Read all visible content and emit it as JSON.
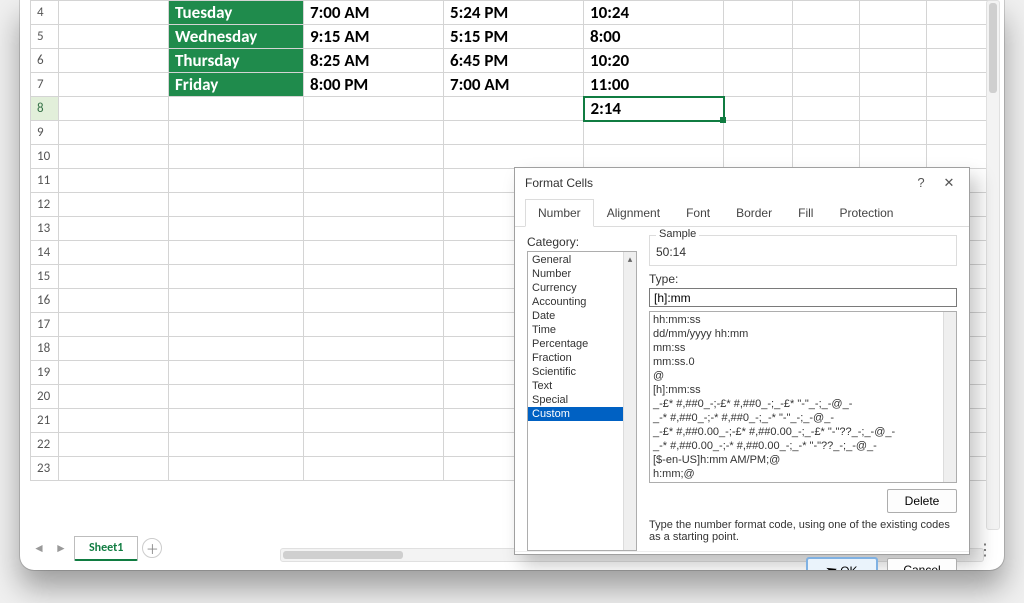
{
  "sheet": {
    "rows": [
      {
        "n": "4",
        "day": "Tuesday",
        "start": "7:00 AM",
        "end": "5:24 PM",
        "dur": "10:24"
      },
      {
        "n": "5",
        "day": "Wednesday",
        "start": "9:15 AM",
        "end": "5:15 PM",
        "dur": "8:00"
      },
      {
        "n": "6",
        "day": "Thursday",
        "start": "8:25 AM",
        "end": "6:45 PM",
        "dur": "10:20"
      },
      {
        "n": "7",
        "day": "Friday",
        "start": "8:00 PM",
        "end": "7:00 AM",
        "dur": "11:00"
      }
    ],
    "sumrow": {
      "n": "8",
      "total": "2:14"
    },
    "empty_rows": [
      "9",
      "10",
      "11",
      "12",
      "13",
      "14",
      "15",
      "16",
      "17",
      "18",
      "19",
      "20",
      "21",
      "22",
      "23"
    ],
    "tab_name": "Sheet1"
  },
  "dialog": {
    "title": "Format Cells",
    "tabs": [
      "Number",
      "Alignment",
      "Font",
      "Border",
      "Fill",
      "Protection"
    ],
    "active_tab": "Number",
    "category_label": "Category:",
    "categories": [
      "General",
      "Number",
      "Currency",
      "Accounting",
      "Date",
      "Time",
      "Percentage",
      "Fraction",
      "Scientific",
      "Text",
      "Special",
      "Custom"
    ],
    "selected_category": "Custom",
    "sample_label": "Sample",
    "sample_value": "50:14",
    "type_label": "Type:",
    "type_value": "[h]:mm",
    "format_list": [
      "hh:mm:ss",
      "dd/mm/yyyy hh:mm",
      "mm:ss",
      "mm:ss.0",
      "@",
      "[h]:mm:ss",
      "_-£* #,##0_-;-£* #,##0_-;_-£* \"-\"_-;_-@_-",
      "_-* #,##0_-;-* #,##0_-;_-* \"-\"_-;_-@_-",
      "_-£* #,##0.00_-;-£* #,##0.00_-;_-£* \"-\"??_-;_-@_-",
      "_-* #,##0.00_-;-* #,##0.00_-;_-* \"-\"??_-;_-@_-",
      "[$-en-US]h:mm AM/PM;@",
      "h:mm;@"
    ],
    "delete_label": "Delete",
    "hint": "Type the number format code, using one of the existing codes as a starting point.",
    "ok_label": "OK",
    "cancel_label": "Cancel"
  }
}
